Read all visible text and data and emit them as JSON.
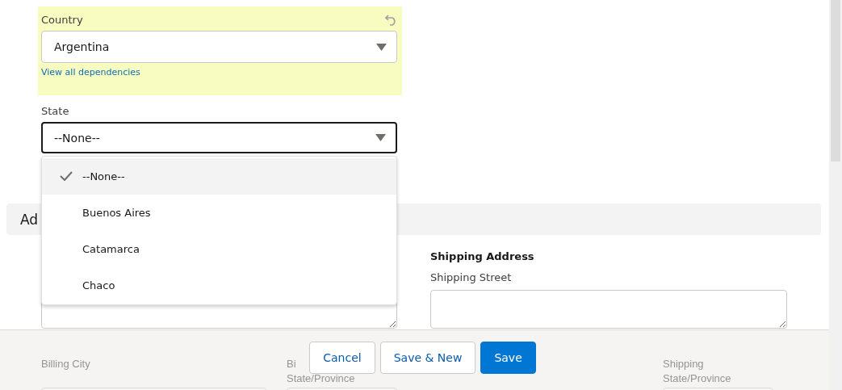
{
  "country_field": {
    "label": "Country",
    "value": "Argentina",
    "link": "View all dependencies",
    "highlighted": true
  },
  "state_field": {
    "label": "State",
    "value": "--None--",
    "focused": true
  },
  "state_dropdown": {
    "options": [
      {
        "label": "--None--",
        "selected": true
      },
      {
        "label": "Buenos Aires",
        "selected": false
      },
      {
        "label": "Catamarca",
        "selected": false
      },
      {
        "label": "Chaco",
        "selected": false
      }
    ]
  },
  "section": {
    "title": "Ad"
  },
  "shipping_address": {
    "heading": "Shipping Address",
    "street_label": "Shipping Street"
  },
  "lower_fields": [
    {
      "lines": [
        "Billing City"
      ]
    },
    {
      "lines": [
        "Bi",
        "State/Province"
      ]
    },
    {
      "lines": [
        "Shipping",
        "State/Province"
      ]
    }
  ],
  "footer": {
    "buttons": [
      {
        "label": "Cancel",
        "kind": "neutral"
      },
      {
        "label": "Save & New",
        "kind": "neutral"
      },
      {
        "label": "Save",
        "kind": "brand"
      }
    ]
  }
}
